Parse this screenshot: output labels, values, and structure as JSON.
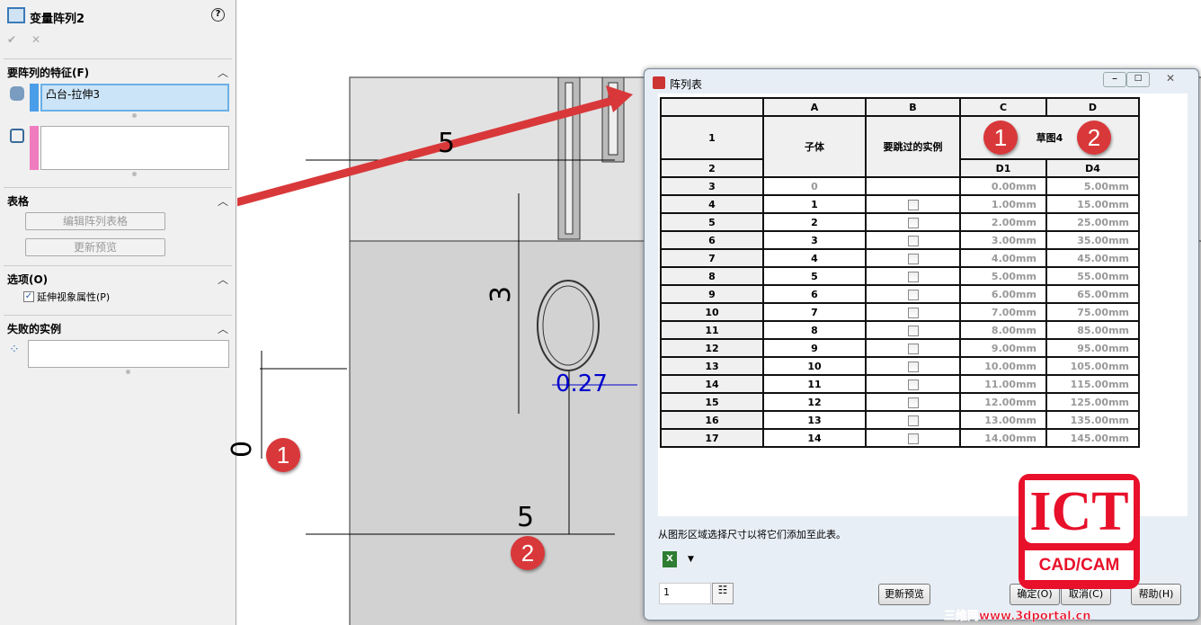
{
  "panel": {
    "title": "变量阵列2",
    "help": "?",
    "ok": "✔",
    "cancel": "✕",
    "features_section": "要阵列的特征(F)",
    "feature_item": "凸台-拉伸3",
    "table_section": "表格",
    "edit_table_button": "编辑阵列表格",
    "update_preview_button": "更新预览",
    "options_section": "选项(O)",
    "extend_visual_label": "延伸视象属性(P)",
    "extend_visual_checked": true,
    "failed_section": "失败的实例"
  },
  "canvas": {
    "dim_top": "5",
    "dim_vert": "3",
    "dim_blue": "0.27",
    "dim_bottom": "5",
    "dim_left": "0"
  },
  "badges": [
    "1",
    "2",
    "1",
    "2"
  ],
  "dialog": {
    "title": "阵列表",
    "col_headers": [
      "A",
      "B",
      "C",
      "D"
    ],
    "row1_label": "1",
    "row2_label": "2",
    "child_header": "子体",
    "skip_header": "要跳过的实例",
    "sketch_header": "草图4",
    "d1": "D1",
    "d4": "D4",
    "rows": [
      {
        "n": "3",
        "a": "0",
        "c": "0.00mm",
        "d": "5.00mm"
      },
      {
        "n": "4",
        "a": "1",
        "c": "1.00mm",
        "d": "15.00mm"
      },
      {
        "n": "5",
        "a": "2",
        "c": "2.00mm",
        "d": "25.00mm"
      },
      {
        "n": "6",
        "a": "3",
        "c": "3.00mm",
        "d": "35.00mm"
      },
      {
        "n": "7",
        "a": "4",
        "c": "4.00mm",
        "d": "45.00mm"
      },
      {
        "n": "8",
        "a": "5",
        "c": "5.00mm",
        "d": "55.00mm"
      },
      {
        "n": "9",
        "a": "6",
        "c": "6.00mm",
        "d": "65.00mm"
      },
      {
        "n": "10",
        "a": "7",
        "c": "7.00mm",
        "d": "75.00mm"
      },
      {
        "n": "11",
        "a": "8",
        "c": "8.00mm",
        "d": "85.00mm"
      },
      {
        "n": "12",
        "a": "9",
        "c": "9.00mm",
        "d": "95.00mm"
      },
      {
        "n": "13",
        "a": "10",
        "c": "10.00mm",
        "d": "105.00mm"
      },
      {
        "n": "14",
        "a": "11",
        "c": "11.00mm",
        "d": "115.00mm"
      },
      {
        "n": "15",
        "a": "12",
        "c": "12.00mm",
        "d": "125.00mm"
      },
      {
        "n": "16",
        "a": "13",
        "c": "13.00mm",
        "d": "135.00mm"
      },
      {
        "n": "17",
        "a": "14",
        "c": "14.00mm",
        "d": "145.00mm"
      }
    ],
    "hint": "从图形区域选择尺寸以将它们添加至此表。",
    "count_value": "1",
    "update_preview": "更新预览(U)",
    "ok": "确定(O)",
    "cancel": "取消(C)",
    "help": "帮助(H)"
  },
  "watermark": {
    "logo_top": "ICT",
    "logo_bottom": "CAD/CAM",
    "site": "三维网www.3dportal.cn"
  },
  "colors": {
    "accent_red": "#d9383a",
    "selection_blue": "#cce4f7"
  }
}
